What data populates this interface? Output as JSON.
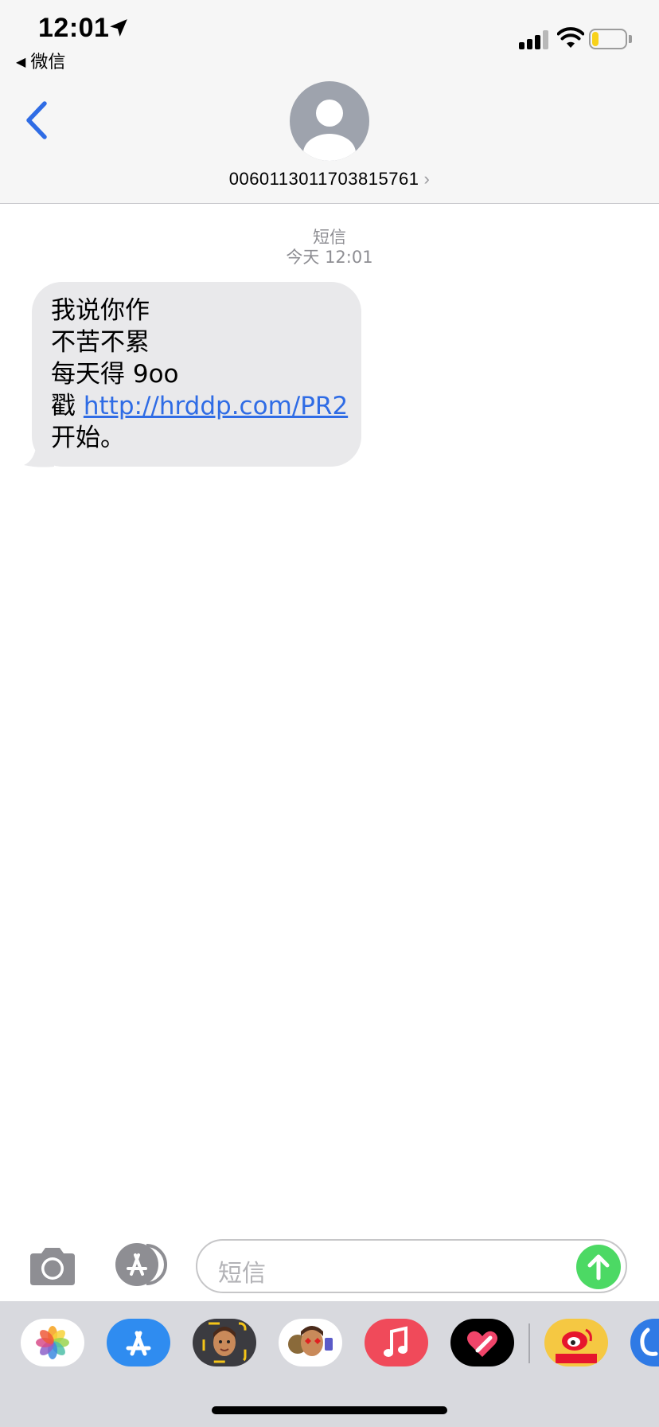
{
  "status_bar": {
    "time": "12:01",
    "back_app_label": "微信"
  },
  "nav": {
    "contact_number": "0060113011703815761",
    "chevron": "›"
  },
  "conversation": {
    "service_label": "短信",
    "timestamp": "今天 12:01",
    "message": {
      "line1": "我说你作",
      "line2": "不苦不累",
      "line3": "每天得 9oo",
      "line4_prefix": "戳 ",
      "link": "http://hrddp.com/PR2",
      "line5": "开始。"
    }
  },
  "compose": {
    "placeholder": "短信"
  },
  "drawer": {
    "apps": [
      "photos-icon",
      "app-store-icon",
      "memoji-icon",
      "animoji-icon",
      "music-icon",
      "digital-touch-icon",
      "weibo-icon",
      "app-icon-partial"
    ]
  },
  "colors": {
    "accent_blue": "#2f6ce5",
    "bubble_gray": "#e9e9eb",
    "send_green": "#4cd964",
    "battery_yellow": "#f8d21b"
  },
  "battery_level_percent": 20
}
